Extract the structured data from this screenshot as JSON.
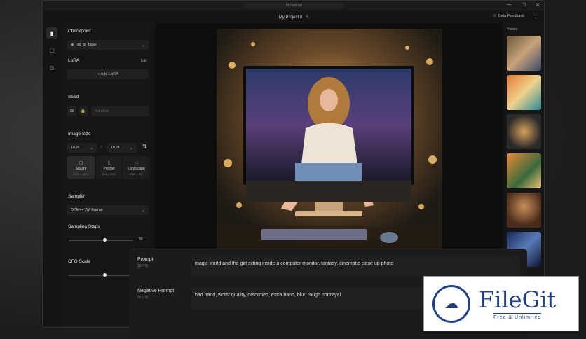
{
  "window": {
    "title": "Noveline",
    "controls": [
      "—",
      "☐",
      "✕"
    ]
  },
  "header": {
    "project_name": "My Project 8",
    "beta_feedback": "Beta Feedback",
    "menu_icon": "⋮"
  },
  "rail": {
    "icons": [
      "page-icon",
      "chat-icon",
      "compass-icon"
    ]
  },
  "panel": {
    "checkpoint_label": "Checkpoint",
    "checkpoint_value": "sd_xl_base",
    "lora_label": "LoRA",
    "lora_edit": "Edit",
    "add_lora": "+ Add LoRA",
    "seed_label": "Seed",
    "seed_placeholder": "Random",
    "image_size_label": "Image Size",
    "width": "1024",
    "height": "1024",
    "times": "×",
    "size_options": [
      {
        "label": "Square",
        "dims": "1024 × 1024"
      },
      {
        "label": "Portrait",
        "dims": "896 × 1152"
      },
      {
        "label": "Landscape",
        "dims": "1152 × 896"
      }
    ],
    "sampler_label": "Sampler",
    "sampler_value": "DPM++ 2M Karras",
    "sampling_steps_label": "Sampling Steps",
    "sampling_steps_value": "30",
    "sampling_steps_level": 0.47,
    "cfg_scale_label": "CFG Scale",
    "cfg_scale_level": 0.47
  },
  "history": {
    "label": "History"
  },
  "prompt": {
    "prompt_label": "Prompt",
    "prompt_count": "16 / 75",
    "prompt_text": "magic world and the girl sitting inside a computer monitor, fantasy, cinematic close up photo",
    "negative_label": "Negative Prompt",
    "negative_count": "15 / 75",
    "negative_text": "bad hand, worst quality, deformed, extra hand, blur, rough portrayal"
  },
  "watermark": {
    "name": "FileGit",
    "tagline": "Free & Unlimited"
  }
}
